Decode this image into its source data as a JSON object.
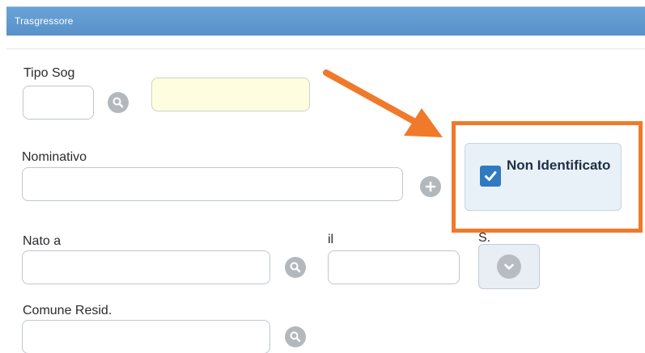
{
  "header": {
    "title": "Trasgressore"
  },
  "fields": {
    "tipo_sog": {
      "label": "Tipo Sog",
      "value": ""
    },
    "tipo_sog_desc": {
      "value": ""
    },
    "nominativo": {
      "label": "Nominativo",
      "value": ""
    },
    "nato_a": {
      "label": "Nato a",
      "value": ""
    },
    "il": {
      "label": "il",
      "value": ""
    },
    "sesso": {
      "label": "S."
    },
    "comune_resid": {
      "label": "Comune Resid.",
      "value": ""
    }
  },
  "checkbox": {
    "label": "Non Identificato",
    "checked": true
  },
  "colors": {
    "header": "#5891c9",
    "highlight": "#f07a2a",
    "checkbox": "#2f7ac0",
    "lookup_field": "#fffde0"
  },
  "icons": {
    "lookup": "search-icon",
    "add": "plus-icon",
    "dropdown": "chevron-down-icon",
    "annotation": "arrow-icon"
  }
}
